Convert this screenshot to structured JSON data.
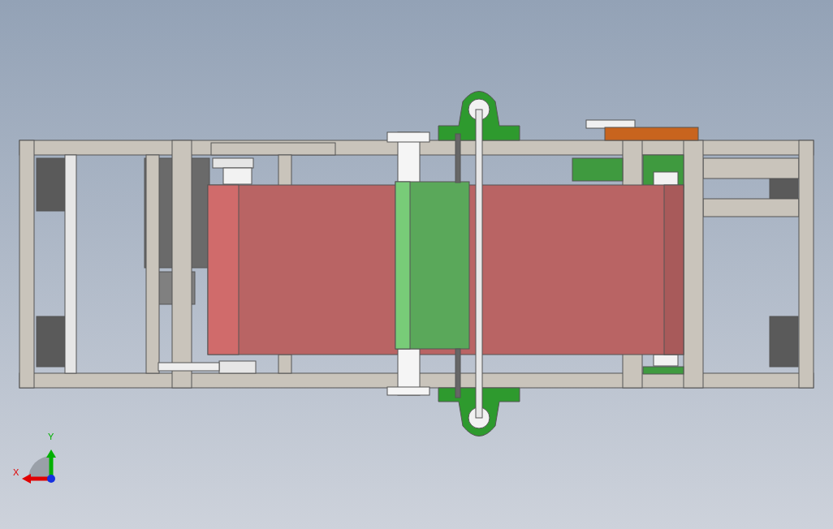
{
  "triad": {
    "axes": [
      {
        "label": "X",
        "color": "#e00000"
      },
      {
        "label": "Y",
        "color": "#00b000"
      }
    ]
  }
}
